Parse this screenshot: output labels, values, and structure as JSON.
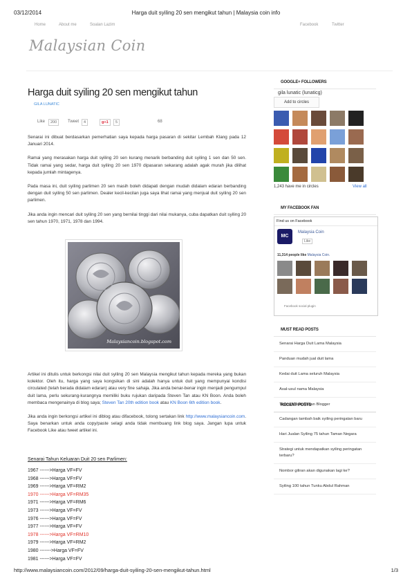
{
  "print_header": {
    "date": "03/12/2014",
    "page_title": "Harga duit syiling 20 sen mengikut tahun | Malaysia coin info"
  },
  "print_footer": {
    "url": "http://www.malaysiancoin.com/2012/09/harga-duit-syiling-20-sen-mengikut-tahun.html",
    "page": "1/3"
  },
  "nav": {
    "home": "Home",
    "about": "About me",
    "soalan": "Soalan Lazim",
    "facebook": "Facebook",
    "twitter": "Twitter"
  },
  "site": {
    "logo": "Malaysian Coin"
  },
  "post": {
    "title": "Harga duit syiling 20 sen mengikut tahun",
    "author": "GILA LUNATIC",
    "social": {
      "like": "Like",
      "like_count": "200",
      "tweet": "Tweet",
      "tweet_count": "4",
      "gplus": "+1",
      "gplus_count": "5",
      "other": "68"
    },
    "paragraphs": [
      "Senarai ini dibuat berdasarkan pemerhatian saya kepada harga pasaran di sekitar Lembah Klang pada 12 Januari 2014.",
      "Ramai yang merasakan harga duit syiling 20 sen kurang menarik berbanding duit syiling 1 sen dan 50 sen. Tidak ramai yang sedar, harga duit syiling 20 sen 1970 dipasaran sekarang adalah agak murah jika dilihat kepada jumlah mintagenya.",
      "Pada masa ini, duit syiling parlimen 20 sen masih boleh didapati dengan mudah didalam edaran berbanding dengan duit syiling 50 sen parlimen. Dealer kecil-kecilan juga saya lihat ramai yang menjual duit syiling 20 sen parlimen.",
      "Jika anda ingin mencari duit syiling 20 sen yang bernilai tinggi dari nilai mukanya, cuba dapatkan duit syiling 20 sen tahun 1970, 1971, 1978 dan 1994."
    ],
    "image_caption": "Malaysiancoin.blogspot.com",
    "para5_a": "Artikel ini ditulis untuk berkongsi nilai duit syiling 20 sen Malaysia mengikut tahun kepada mereka yang bukan kolektor. Oleh itu, harga yang saya kongsikan di sini adalah hanya untuk duit yang mempunyai kondisi circulated (telah berada didalam edaran) atau very fine sahaja. Jika anda benar-benar ingin menjadi pengumpul duit lama, perlu sekurang-kurangnya memiliki buku rujukan daripada Steven Tan atau KN Boon. Anda boleh membaca mengenainya di blog saya; ",
    "link_steven": "Steven Tan 20th edition book",
    "para5_b": " atau ",
    "link_knboon": "KN Boon 6th edition book",
    "para5_c": ".",
    "para6_a": "Jika anda ingin berkongsi artikel ini diblog atau difacebook, tolong sertakan link ",
    "para6_link": "http://www.malaysiancoin.com",
    "para6_b": ". Saya benarkan untuk anda copy/paste selagi anda tidak membuang link blog saya. Jangan lupa untuk Facebook Like atau tweet artikel ini.",
    "years_title": "Senarai Tahun Keluaran Duit 20 sen Parlimen:",
    "years": [
      {
        "text": "1967 ------>Harga VF=FV",
        "highlight": false
      },
      {
        "text": "1968 ------>Harga VF=FV",
        "highlight": false
      },
      {
        "text": "1969 ------>Harga VF=RM2",
        "highlight": false
      },
      {
        "text": "1970 ------>Harga VF=RM35",
        "highlight": true
      },
      {
        "text": "1971 ------>Harga VF=RM6",
        "highlight": false
      },
      {
        "text": "1973 ------>Harga VF=FV",
        "highlight": false
      },
      {
        "text": "1976 ------>Harga VF=FV",
        "highlight": false
      },
      {
        "text": "1977 ------>Harga VF=FV",
        "highlight": false
      },
      {
        "text": "1978 ------>Harga VF=RM10",
        "highlight": true
      },
      {
        "text": "1979 ------>Harga VF=RM2",
        "highlight": false
      },
      {
        "text": "1980 ------->Harga VF=FV",
        "highlight": false
      },
      {
        "text": "1981 ------>Harga VF=FV",
        "highlight": false
      }
    ]
  },
  "sidebar": {
    "gplus": {
      "heading": "GOOGLE+ FOLLOWERS",
      "name": "gila lunatic (lunaticg)",
      "add": "Add to circles",
      "count": "1,243 have me in circles",
      "view_all": "View all"
    },
    "fb": {
      "heading": "MY FACEBOOK FAN",
      "find": "Find us on Facebook",
      "name": "Malaysia Coin",
      "like": "Like",
      "people_count": "11,314 people like",
      "people_page": "Malaysia Coin.",
      "plugin": "Facebook social plugin"
    },
    "must_read": {
      "heading": "MUST READ POSTS",
      "items": [
        "Senarai Harga Duit Lama Malaysia",
        "Panduan mudah jual duit lama",
        "Kedai duit Lama seluruh Malaysia",
        "Asal-usul nama Malaysia",
        "Terima Kasih Rakan Blogger"
      ]
    },
    "recent": {
      "heading": "RECENT POSTS",
      "items": [
        "Cadangan tambah baik syiling peringatan baru",
        "Hari Jualan Syiling 75 tahun Taman Negara",
        "Strategi untuk mendapatkan syiling peringatan terbaru?",
        "Nombor giliran akan digunakan lagi ke?",
        "Syiling 100 tahun Tunku Abdul Rahman"
      ]
    }
  },
  "colors": {
    "link": "#2a6bd3",
    "highlight": "#e0332a",
    "fb_blue": "#3b5998"
  }
}
